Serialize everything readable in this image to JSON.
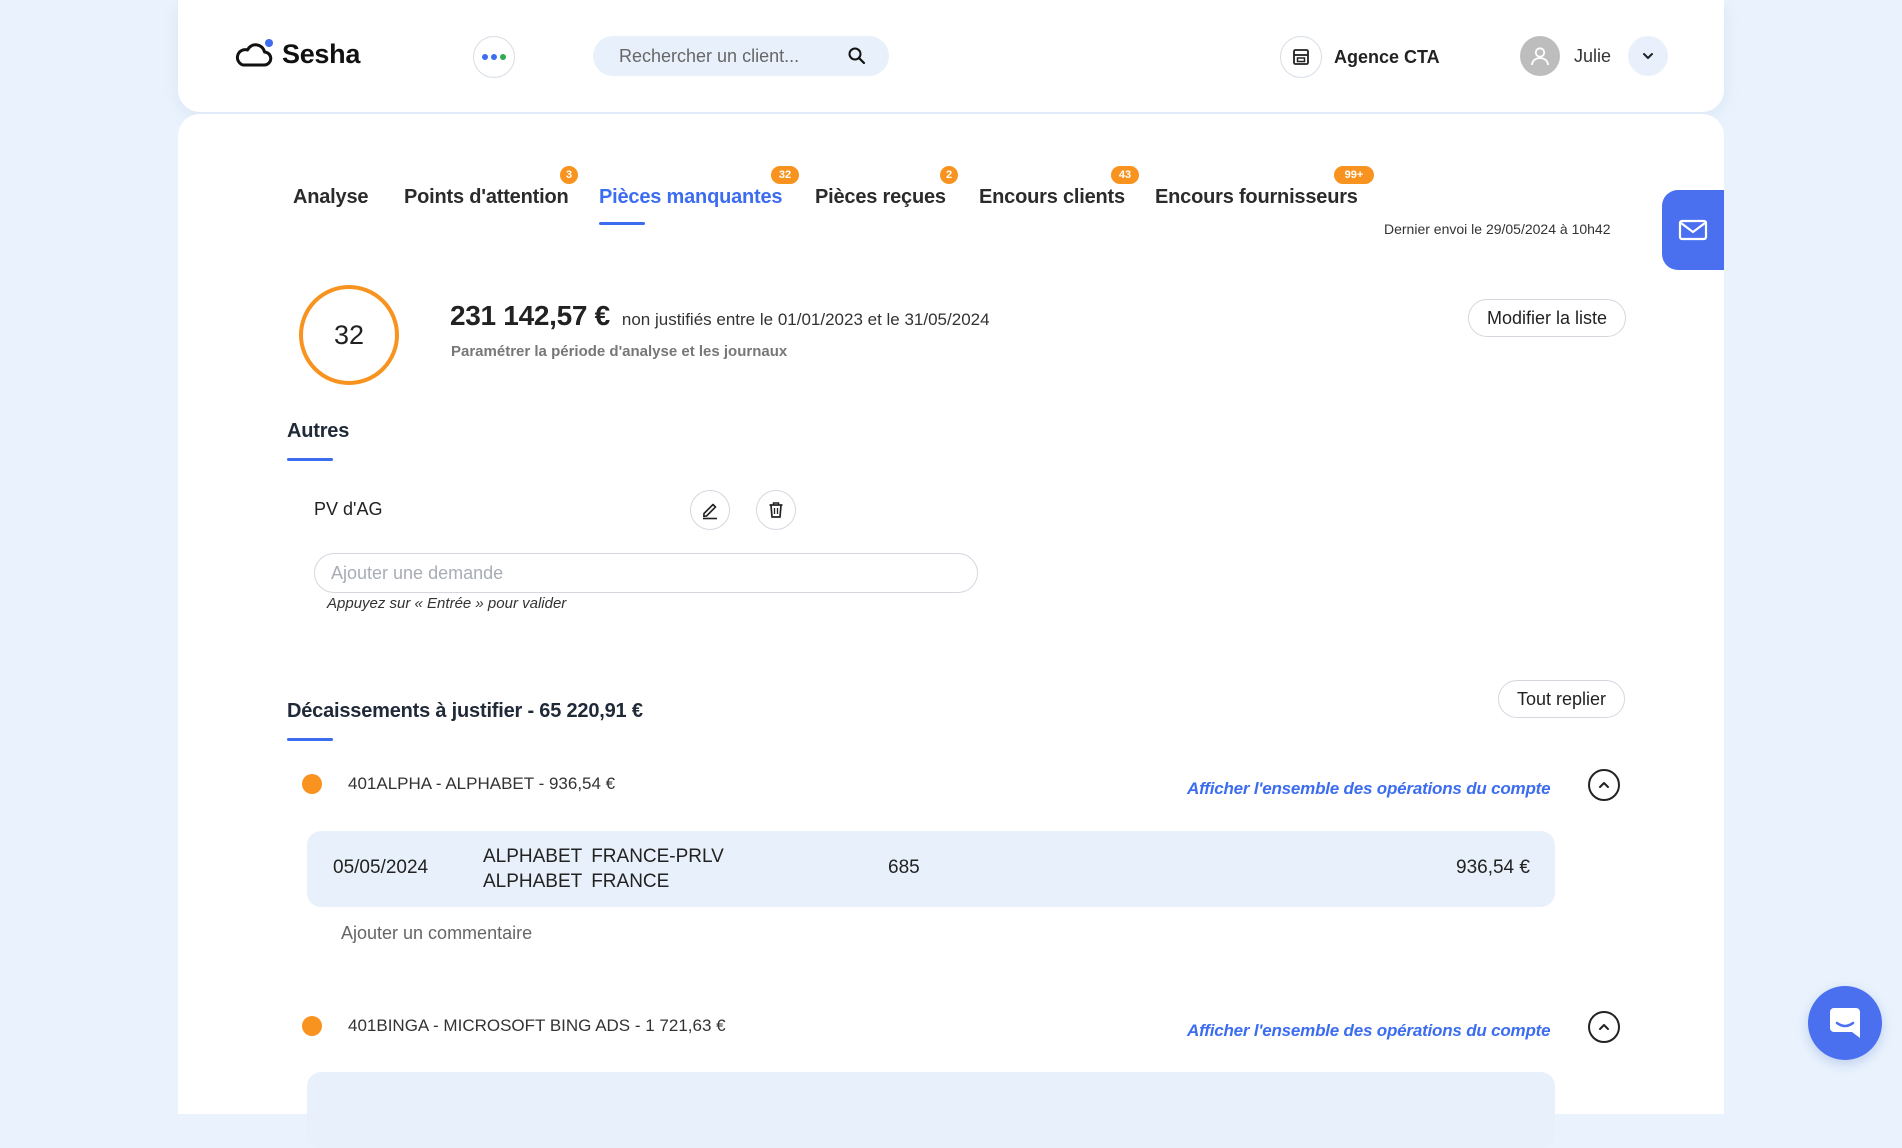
{
  "header": {
    "app_name": "Sesha",
    "search_placeholder": "Rechercher un client...",
    "agency": "Agence CTA",
    "user_name": "Julie"
  },
  "colors": {
    "accent": "#3c6df0",
    "badge": "#f7931e",
    "dots": [
      "#3c6df0",
      "#3c6df0",
      "#2eaa4f"
    ]
  },
  "tabs": [
    {
      "label": "Analyse",
      "badge": ""
    },
    {
      "label": "Points d'attention",
      "badge": "3"
    },
    {
      "label": "Pièces manquantes",
      "badge": "32",
      "active": true
    },
    {
      "label": "Pièces reçues",
      "badge": "2"
    },
    {
      "label": "Encours clients",
      "badge": "43"
    },
    {
      "label": "Encours fournisseurs",
      "badge": "99+"
    }
  ],
  "last_sent": "Dernier envoi le 29/05/2024 à 10h42",
  "summary": {
    "count": "32",
    "amount": "231 142,57 €",
    "description": "non justifiés entre le 01/01/2023 et le 31/05/2024",
    "period_link": "Paramétrer la période d'analyse et les journaux",
    "edit_list_button": "Modifier la liste"
  },
  "others": {
    "title": "Autres",
    "items": [
      {
        "label": "PV d'AG"
      }
    ],
    "add_placeholder": "Ajouter une demande",
    "hint": "Appuyez sur « Entrée » pour valider"
  },
  "disbursements": {
    "title": "Décaissements à justifier - 65 220,91 €",
    "collapse_button": "Tout replier",
    "show_all_link": "Afficher l'ensemble des opérations du compte",
    "add_comment": "Ajouter un commentaire",
    "accounts": [
      {
        "label": "401ALPHA - ALPHABET - 936,54 €",
        "operations": [
          {
            "date": "05/05/2024",
            "label": "ALPHABET FRANCE-PRLV ALPHABET FRANCE",
            "account": "685",
            "amount": "936,54 €"
          }
        ]
      },
      {
        "label": "401BINGA - MICROSOFT BING ADS - 1 721,63 €",
        "operations": []
      }
    ]
  }
}
